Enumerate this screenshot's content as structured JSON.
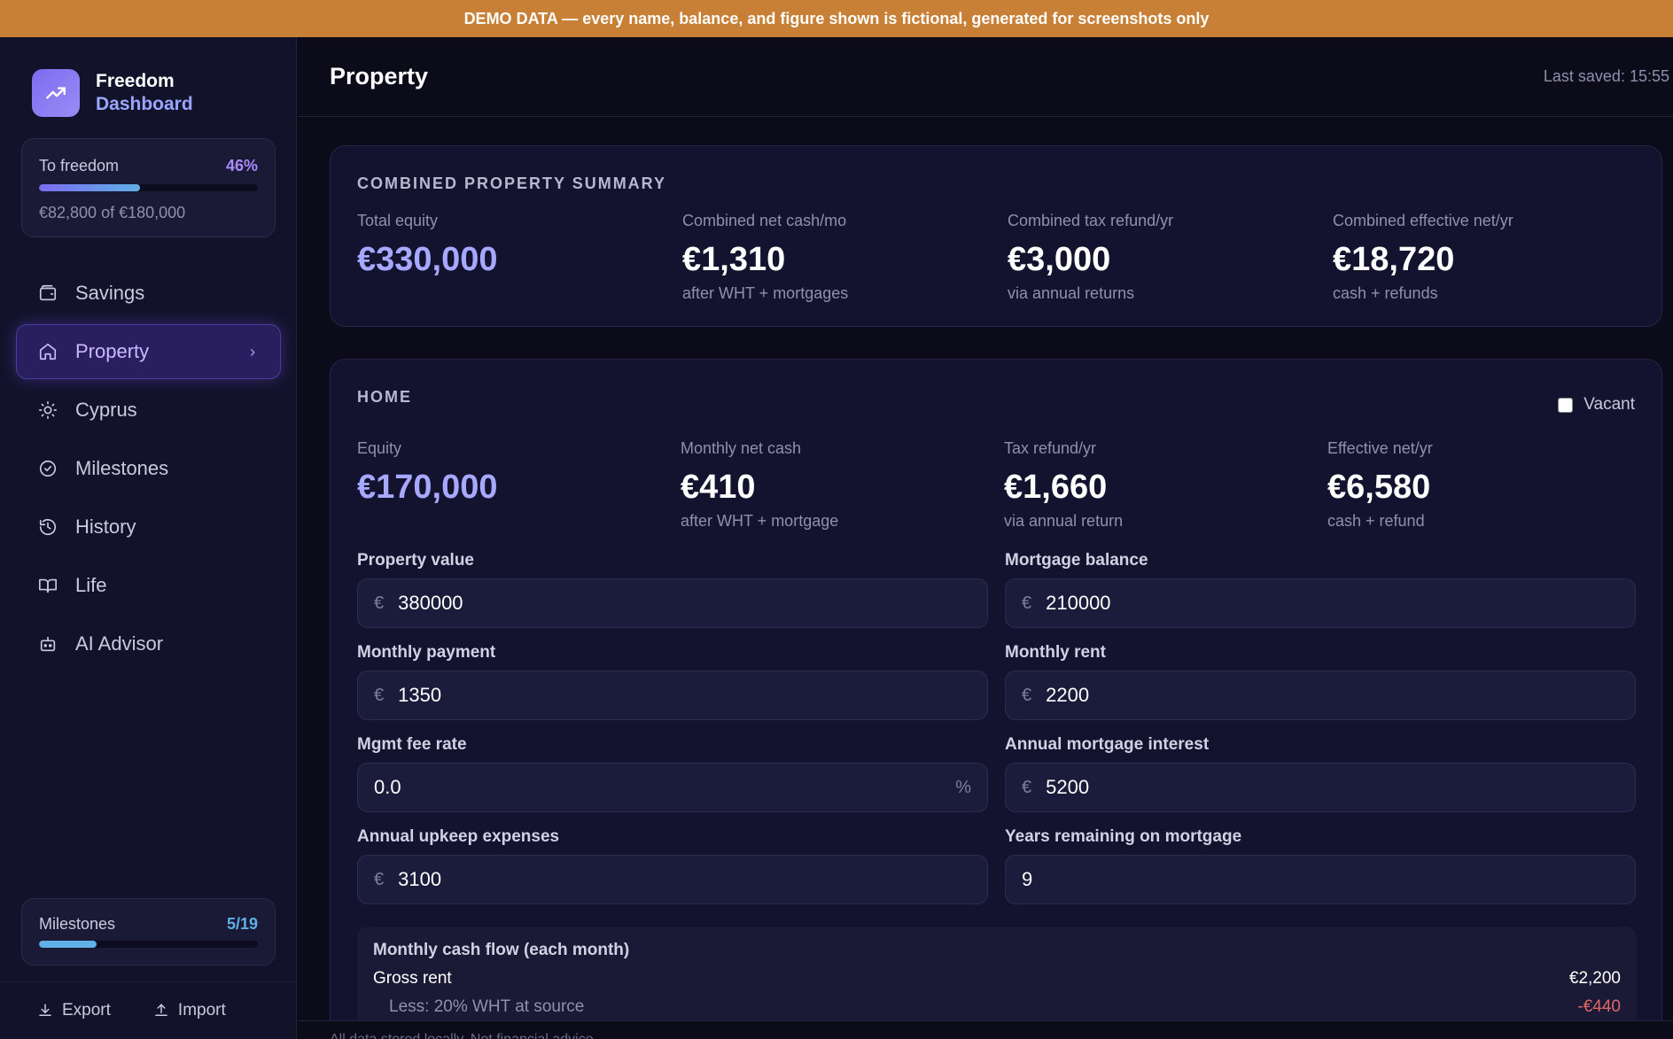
{
  "banner": "DEMO DATA — every name, balance, and figure shown is fictional, generated for screenshots only",
  "brand": {
    "line1": "Freedom",
    "line2": "Dashboard"
  },
  "freedom_progress": {
    "label": "To freedom",
    "percent_text": "46%",
    "fraction": 0.46,
    "sub": "€82,800 of €180,000"
  },
  "nav": [
    {
      "label": "Savings",
      "icon": "wallet-icon"
    },
    {
      "label": "Property",
      "icon": "home-icon",
      "active": true
    },
    {
      "label": "Cyprus",
      "icon": "sun-icon"
    },
    {
      "label": "Milestones",
      "icon": "check-circle-icon"
    },
    {
      "label": "History",
      "icon": "history-icon"
    },
    {
      "label": "Life",
      "icon": "book-icon"
    },
    {
      "label": "AI Advisor",
      "icon": "robot-icon"
    }
  ],
  "milestones_progress": {
    "label": "Milestones",
    "count_text": "5/19",
    "fraction": 0.263
  },
  "footer": {
    "export": "Export",
    "import": "Import"
  },
  "header": {
    "title": "Property",
    "last_saved": "Last saved: 15:55"
  },
  "summary": {
    "title": "COMBINED PROPERTY SUMMARY",
    "stats": [
      {
        "label": "Total equity",
        "value": "€330,000",
        "sub": ""
      },
      {
        "label": "Combined net cash/mo",
        "value": "€1,310",
        "sub": "after WHT + mortgages"
      },
      {
        "label": "Combined tax refund/yr",
        "value": "€3,000",
        "sub": "via annual returns"
      },
      {
        "label": "Combined effective net/yr",
        "value": "€18,720",
        "sub": "cash + refunds"
      }
    ]
  },
  "home": {
    "title": "HOME",
    "vacant_label": "Vacant",
    "stats": [
      {
        "label": "Equity",
        "value": "€170,000",
        "sub": ""
      },
      {
        "label": "Monthly net cash",
        "value": "€410",
        "sub": "after WHT + mortgage"
      },
      {
        "label": "Tax refund/yr",
        "value": "€1,660",
        "sub": "via annual return"
      },
      {
        "label": "Effective net/yr",
        "value": "€6,580",
        "sub": "cash + refund"
      }
    ],
    "fields": {
      "property_value": {
        "label": "Property value",
        "value": "380000",
        "prefix": "€"
      },
      "mortgage_balance": {
        "label": "Mortgage balance",
        "value": "210000",
        "prefix": "€"
      },
      "monthly_payment": {
        "label": "Monthly payment",
        "value": "1350",
        "prefix": "€"
      },
      "monthly_rent": {
        "label": "Monthly rent",
        "value": "2200",
        "prefix": "€"
      },
      "mgmt_fee_rate": {
        "label": "Mgmt fee rate",
        "value": "0.0",
        "suffix": "%"
      },
      "annual_mortgage_interest": {
        "label": "Annual mortgage interest",
        "value": "5200",
        "prefix": "€"
      },
      "annual_upkeep": {
        "label": "Annual upkeep expenses",
        "value": "3100",
        "prefix": "€"
      },
      "years_remaining": {
        "label": "Years remaining on mortgage",
        "value": "9"
      }
    },
    "cashflow": {
      "title": "Monthly cash flow (each month)",
      "gross_rent_label": "Gross rent",
      "gross_rent_value": "€2,200",
      "wht_label": "Less: 20% WHT at source",
      "wht_value": "-€440"
    }
  },
  "footnote": "All data stored locally. Not financial advice.",
  "colors": {
    "accent": "#a78bfa",
    "banner": "#c87f36",
    "milestone_bar": "#5fb0e6",
    "negative": "#e06666"
  }
}
